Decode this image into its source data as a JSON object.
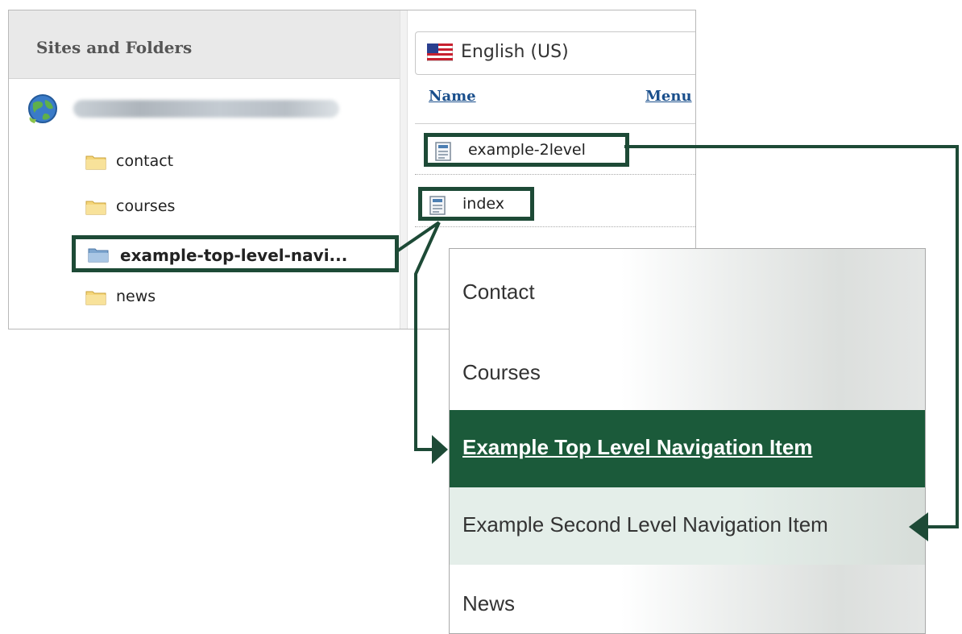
{
  "cms": {
    "left_header": "Sites and Folders",
    "site": {
      "icon": "globe-icon"
    },
    "folders": [
      {
        "label": "contact",
        "icon": "folder-icon"
      },
      {
        "label": "courses",
        "icon": "folder-icon"
      },
      {
        "label": "example-top-level-navi...",
        "icon": "folder-open-icon",
        "highlighted": true
      },
      {
        "label": "news",
        "icon": "folder-icon"
      }
    ],
    "language": {
      "label": "English (US)",
      "icon": "us-flag-icon"
    },
    "columns": [
      "Name",
      "Menu"
    ],
    "pages": [
      {
        "label": "example-2level",
        "icon": "page-icon",
        "highlighted": true
      },
      {
        "label": "index",
        "icon": "page-icon",
        "highlighted": true
      }
    ]
  },
  "nav": {
    "items": [
      {
        "label": "Contact"
      },
      {
        "label": "Courses"
      },
      {
        "label": "Example Top Level Navigation Item",
        "active": true
      },
      {
        "label": "Example Second Level Navigation Item"
      },
      {
        "label": "News"
      }
    ]
  },
  "colors": {
    "highlight_border": "#1d4a36",
    "nav_active": "#1b5a3a",
    "link_blue": "#1a4f8c"
  }
}
